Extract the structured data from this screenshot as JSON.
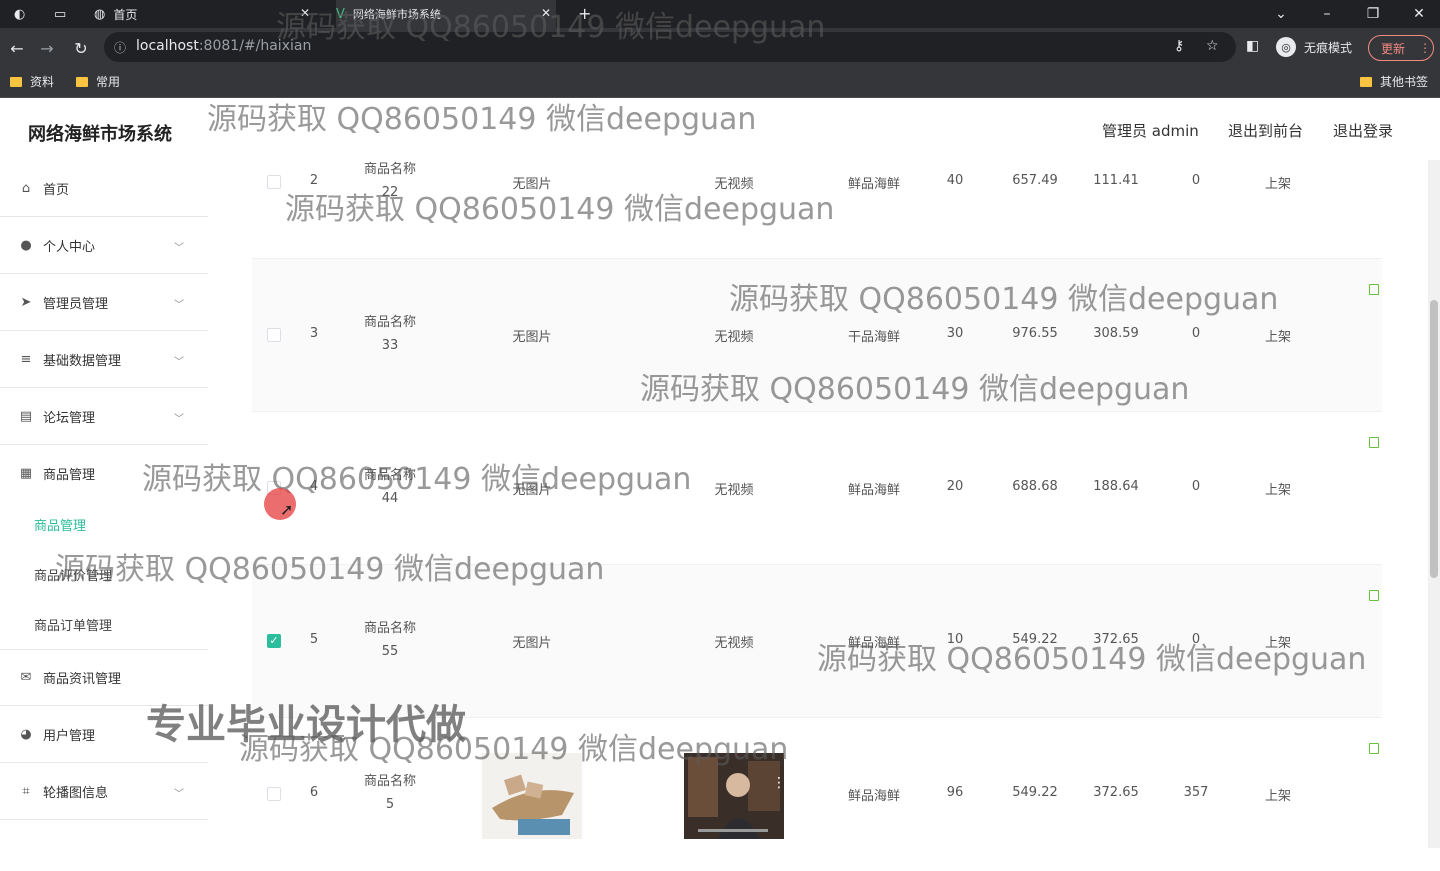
{
  "browser": {
    "tabs": [
      {
        "label": "首页"
      },
      {
        "label": "网络海鲜市场系统"
      }
    ],
    "url_host": "localhost",
    "url_rest": ":8081/#/haixian",
    "incognito_label": "无痕模式",
    "update_label": "更新",
    "bookmarks": [
      "资料",
      "常用"
    ],
    "other_bookmarks": "其他书签"
  },
  "header": {
    "title": "网络海鲜市场系统",
    "user": "管理员 admin",
    "to_front": "退出到前台",
    "logout": "退出登录"
  },
  "sidebar": {
    "items": [
      {
        "label": "首页"
      },
      {
        "label": "个人中心"
      },
      {
        "label": "管理员管理"
      },
      {
        "label": "基础数据管理"
      },
      {
        "label": "论坛管理"
      },
      {
        "label": "商品管理"
      },
      {
        "label": "商品资讯管理"
      },
      {
        "label": "用户管理"
      },
      {
        "label": "轮播图信息"
      }
    ],
    "submenu": [
      {
        "label": "商品管理"
      },
      {
        "label": "商品评价管理"
      },
      {
        "label": "商品订单管理"
      }
    ]
  },
  "table": {
    "rows": [
      {
        "id": "2",
        "name": "商品名称",
        "name2": "22",
        "img": "无图片",
        "video": "无视频",
        "type": "鲜品海鲜",
        "stock": "40",
        "price1": "657.49",
        "price2": "111.41",
        "clicks": "0",
        "status": "上架",
        "checked": false
      },
      {
        "id": "3",
        "name": "商品名称",
        "name2": "33",
        "img": "无图片",
        "video": "无视频",
        "type": "干品海鲜",
        "stock": "30",
        "price1": "976.55",
        "price2": "308.59",
        "clicks": "0",
        "status": "上架",
        "checked": false
      },
      {
        "id": "4",
        "name": "商品名称",
        "name2": "44",
        "img": "无图片",
        "video": "无视频",
        "type": "鲜品海鲜",
        "stock": "20",
        "price1": "688.68",
        "price2": "188.64",
        "clicks": "0",
        "status": "上架",
        "checked": false
      },
      {
        "id": "5",
        "name": "商品名称",
        "name2": "55",
        "img": "无图片",
        "video": "无视频",
        "type": "鲜品海鲜",
        "stock": "10",
        "price1": "549.22",
        "price2": "372.65",
        "clicks": "0",
        "status": "上架",
        "checked": true
      },
      {
        "id": "6",
        "name": "商品名称",
        "name2": "5",
        "img": "",
        "video": "",
        "type": "鲜品海鲜",
        "stock": "96",
        "price1": "549.22",
        "price2": "372.65",
        "clicks": "357",
        "status": "上架",
        "checked": false
      }
    ]
  },
  "watermark": {
    "text": "源码获取 QQ86050149 微信deepguan",
    "promo": "专业毕业设计代做"
  }
}
